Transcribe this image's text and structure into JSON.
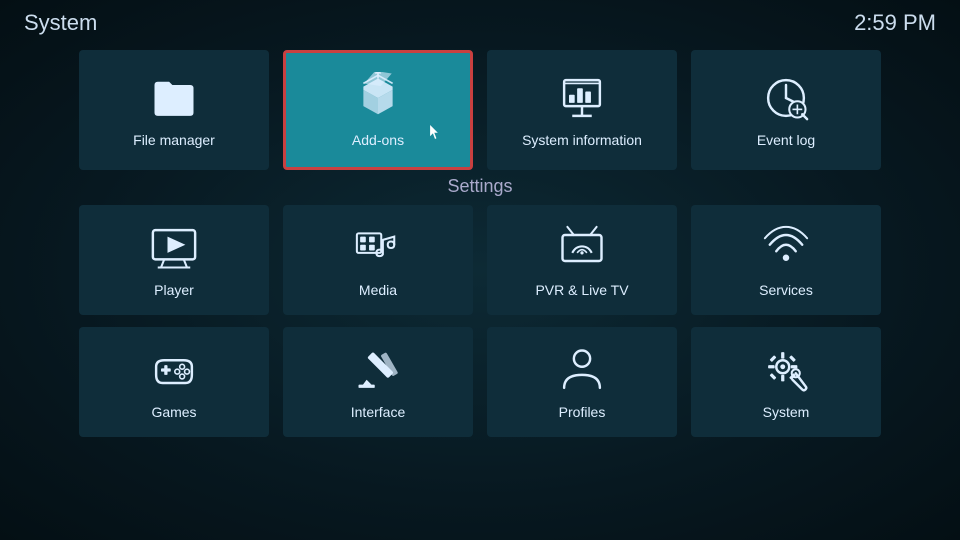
{
  "header": {
    "title": "System",
    "time": "2:59 PM"
  },
  "top_row": [
    {
      "id": "file-manager",
      "label": "File manager",
      "icon": "folder",
      "selected": false
    },
    {
      "id": "add-ons",
      "label": "Add-ons",
      "icon": "addons",
      "selected": true
    },
    {
      "id": "system-information",
      "label": "System information",
      "icon": "sysinfo",
      "selected": false
    },
    {
      "id": "event-log",
      "label": "Event log",
      "icon": "eventlog",
      "selected": false
    }
  ],
  "settings_label": "Settings",
  "settings_rows": [
    [
      {
        "id": "player",
        "label": "Player",
        "icon": "player"
      },
      {
        "id": "media",
        "label": "Media",
        "icon": "media"
      },
      {
        "id": "pvr",
        "label": "PVR & Live TV",
        "icon": "pvr"
      },
      {
        "id": "services",
        "label": "Services",
        "icon": "services"
      }
    ],
    [
      {
        "id": "games",
        "label": "Games",
        "icon": "games"
      },
      {
        "id": "interface",
        "label": "Interface",
        "icon": "interface"
      },
      {
        "id": "profiles",
        "label": "Profiles",
        "icon": "profiles"
      },
      {
        "id": "system",
        "label": "System",
        "icon": "system"
      }
    ]
  ]
}
